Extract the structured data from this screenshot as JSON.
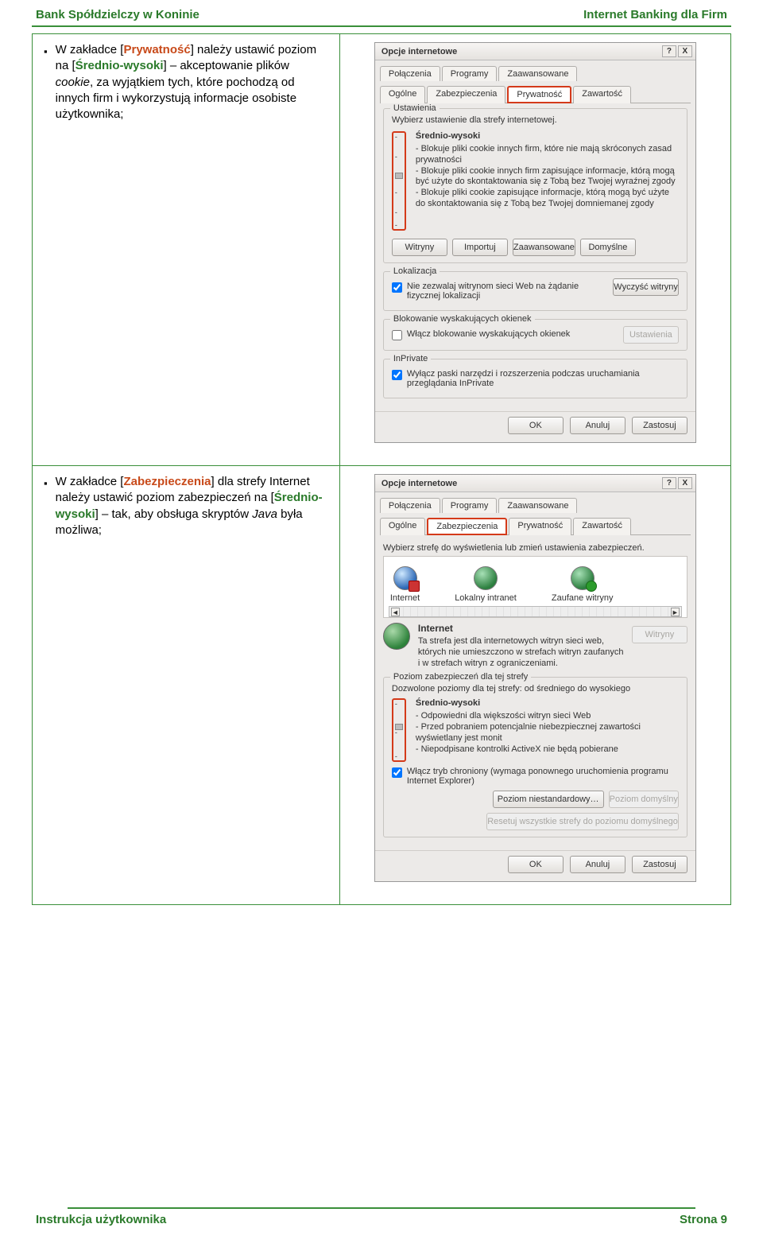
{
  "header": {
    "left": "Bank Spółdzielczy w Koninie",
    "right": "Internet Banking dla Firm"
  },
  "footer": {
    "left": "Instrukcja użytkownika",
    "right": "Strona 9"
  },
  "instr1": {
    "pre": "W zakładce [",
    "kw1": "Prywatność",
    "mid1": "] należy ustawić poziom na [",
    "kw2": "Średnio-wysoki",
    "mid2": "] – akceptowanie plików ",
    "cookie": "cookie",
    "tail": ", za wyjątkiem tych, które pochodzą od innych firm i wykorzystują informacje osobiste użytkownika;"
  },
  "instr2": {
    "pre": "W zakładce [",
    "kw1": "Zabezpieczenia",
    "mid1": "] dla strefy Internet należy ustawić poziom zabezpieczeń na [",
    "kw2": "Średnio-wysoki",
    "mid2": "] – tak, aby obsługa skryptów ",
    "java": "Java",
    "tail": " była możliwa;"
  },
  "dialog": {
    "title": "Opcje internetowe",
    "help": "?",
    "close": "X",
    "tabs_row1": [
      "Połączenia",
      "Programy",
      "Zaawansowane"
    ],
    "tabs_row2": [
      "Ogólne",
      "Zabezpieczenia",
      "Prywatność",
      "Zawartość"
    ]
  },
  "d1": {
    "settings_group": "Ustawienia",
    "intro": "Wybierz ustawienie dla strefy internetowej.",
    "policy_title": "Średnio-wysoki",
    "policy": [
      "- Blokuje pliki cookie innych firm, które nie mają skróconych zasad prywatności",
      "- Blokuje pliki cookie innych firm zapisujące informacje, którą mogą być użyte do skontaktowania się z Tobą bez Twojej wyraźnej zgody",
      "- Blokuje pliki cookie zapisujące informacje, którą mogą być użyte do skontaktowania się z Tobą bez Twojej domniemanej zgody"
    ],
    "btns": [
      "Witryny",
      "Importuj",
      "Zaawansowane",
      "Domyślne"
    ],
    "loc_group": "Lokalizacja",
    "loc_chk": "Nie zezwalaj witrynom sieci Web na żądanie fizycznej lokalizacji",
    "loc_btn": "Wyczyść witryny",
    "pop_group": "Blokowanie wyskakujących okienek",
    "pop_chk": "Włącz blokowanie wyskakujących okienek",
    "pop_btn": "Ustawienia",
    "inp_group": "InPrivate",
    "inp_chk": "Wyłącz paski narzędzi i rozszerzenia podczas uruchamiania przeglądania InPrivate"
  },
  "d2": {
    "prompt": "Wybierz strefę do wyświetlenia lub zmień ustawienia zabezpieczeń.",
    "zones": [
      "Internet",
      "Lokalny intranet",
      "Zaufane witryny"
    ],
    "zone_title": "Internet",
    "zone_desc": "Ta strefa jest dla internetowych witryn sieci web, których nie umieszczono w strefach witryn zaufanych i w strefach witryn z ograniczeniami.",
    "zone_btn": "Witryny",
    "level_group": "Poziom zabezpieczeń dla tej strefy",
    "level_range": "Dozwolone poziomy dla tej strefy: od średniego do wysokiego",
    "level_title": "Średnio-wysoki",
    "level_bullets": [
      "- Odpowiedni dla większości witryn sieci Web",
      "- Przed pobraniem potencjalnie niebezpiecznej zawartości wyświetlany jest monit",
      "- Niepodpisane kontrolki ActiveX nie będą pobierane"
    ],
    "prot_chk": "Włącz tryb chroniony (wymaga ponownego uruchomienia programu Internet Explorer)",
    "custom_btn": "Poziom niestandardowy…",
    "default_btn": "Poziom domyślny",
    "reset_btn": "Resetuj wszystkie strefy do poziomu domyślnego"
  },
  "dlg_buttons": {
    "ok": "OK",
    "cancel": "Anuluj",
    "apply": "Zastosuj"
  }
}
